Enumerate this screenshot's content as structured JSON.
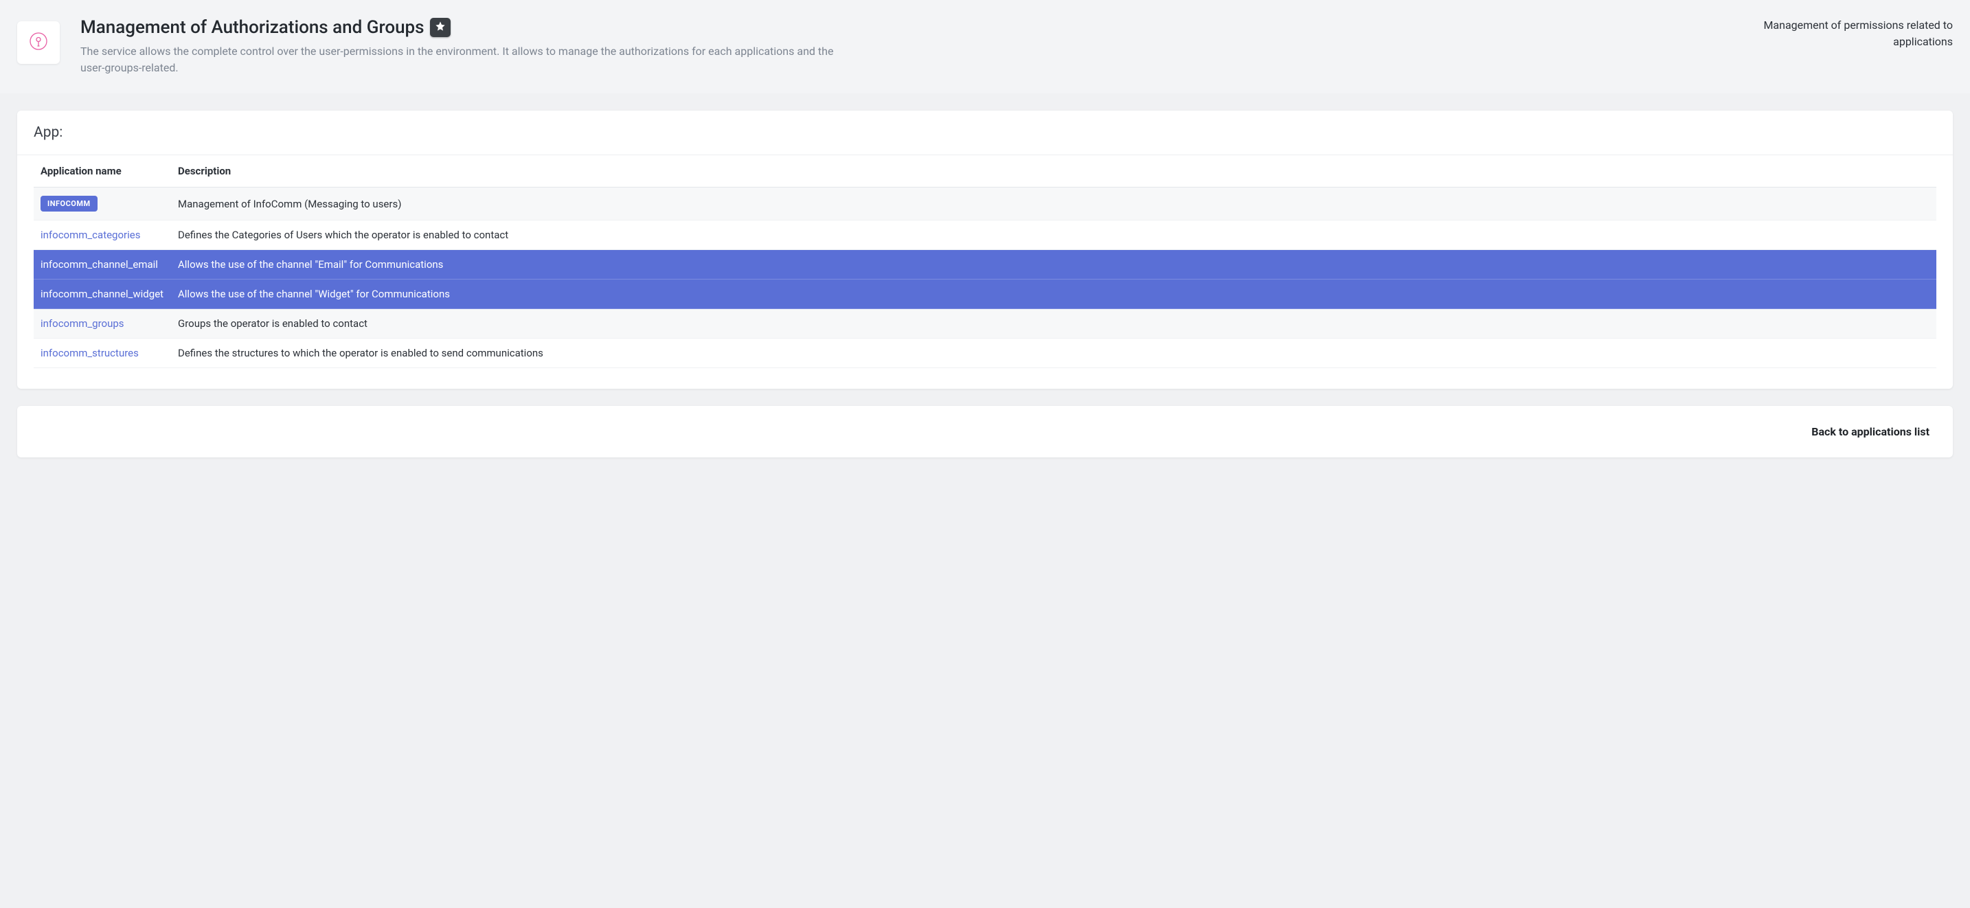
{
  "header": {
    "title": "Management of Authorizations and Groups",
    "description": "The service allows the complete control over the user-permissions in the environment. It allows to manage the authorizations for each applications and the user-groups-related.",
    "right_text": "Management of permissions related to applications"
  },
  "card": {
    "section_title": "App:",
    "columns": {
      "name": "Application name",
      "description": "Description"
    },
    "rows": [
      {
        "name": "INFOCOMM",
        "description": "Management of InfoComm (Messaging to users)",
        "badge": true,
        "selected": false
      },
      {
        "name": "infocomm_categories",
        "description": "Defines the Categories of Users which the operator is enabled to contact",
        "badge": false,
        "selected": false
      },
      {
        "name": "infocomm_channel_email",
        "description": "Allows the use of the channel \"Email\" for Communications",
        "badge": false,
        "selected": true
      },
      {
        "name": "infocomm_channel_widget",
        "description": "Allows the use of the channel \"Widget\" for Communications",
        "badge": false,
        "selected": true
      },
      {
        "name": "infocomm_groups",
        "description": "Groups the operator is enabled to contact",
        "badge": false,
        "selected": false
      },
      {
        "name": "infocomm_structures",
        "description": "Defines the structures to which the operator is enabled to send communications",
        "badge": false,
        "selected": false
      }
    ]
  },
  "footer": {
    "back_label": "Back to applications list"
  }
}
